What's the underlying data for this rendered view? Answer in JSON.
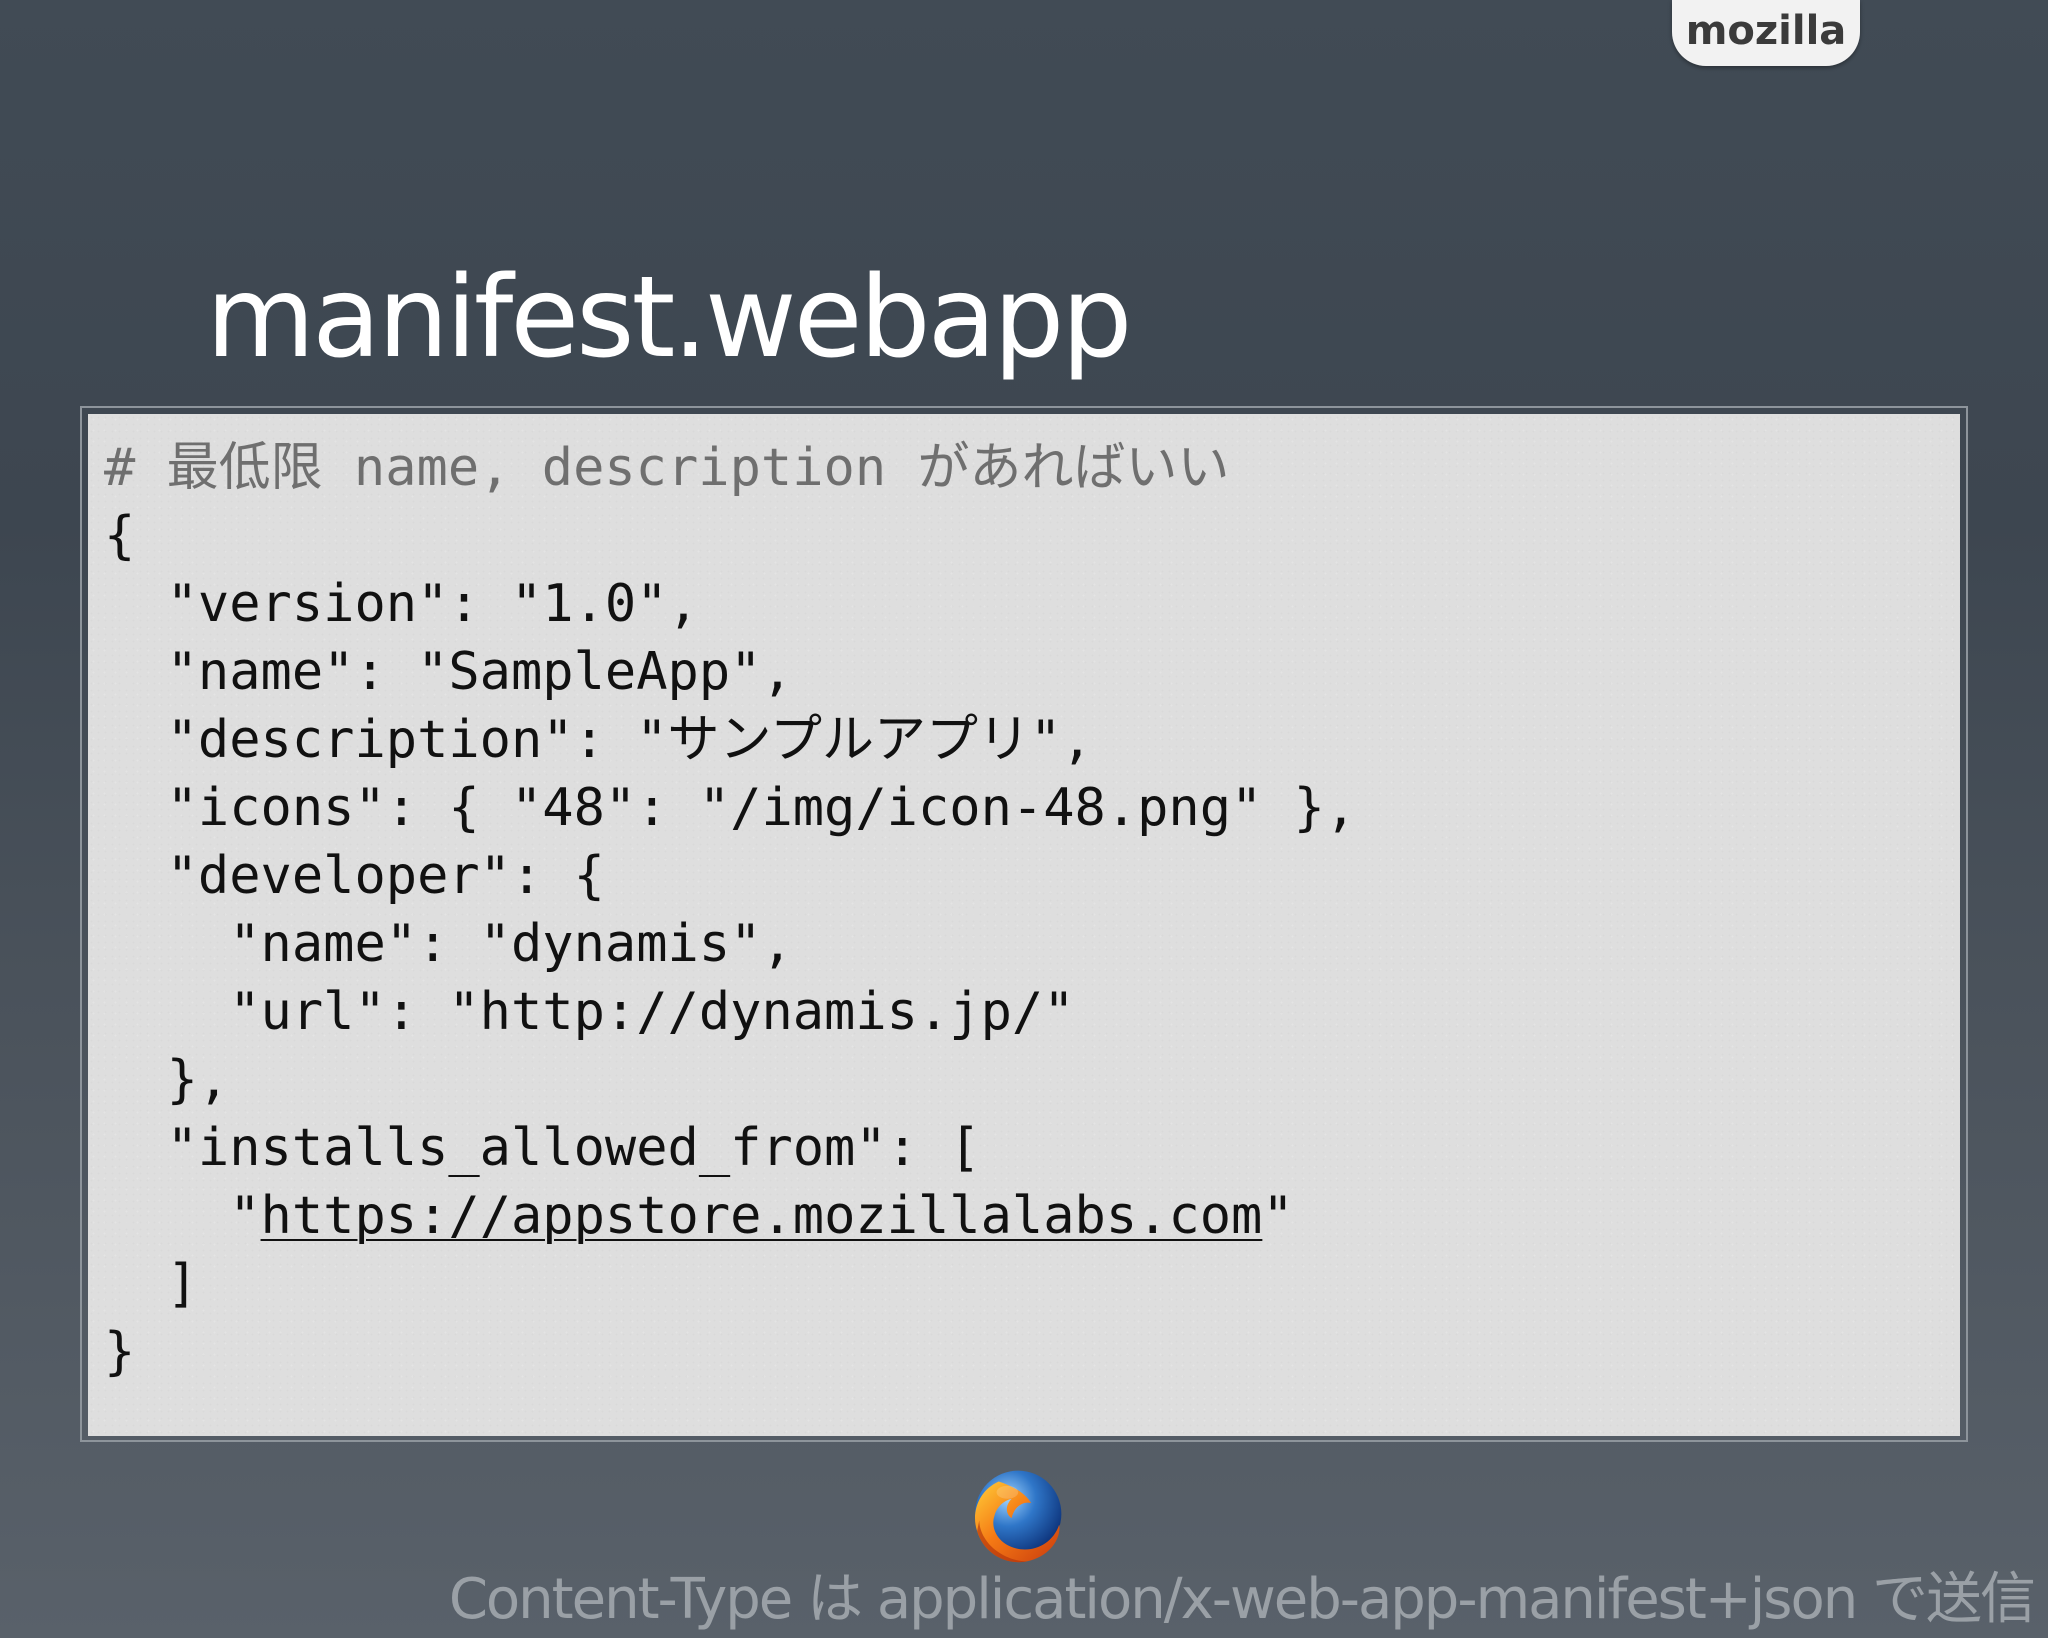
{
  "brand": {
    "label": "mozilla"
  },
  "slide": {
    "title": "manifest.webapp",
    "footer": "Content-Type は application/x-web-app-manifest+json で送信"
  },
  "code": {
    "comment": "# 最低限 name, description があればいい",
    "lines": [
      "{",
      "  \"version\": \"1.0\",",
      "  \"name\": \"SampleApp\",",
      "  \"description\": \"サンプルアプリ\",",
      "  \"icons\": { \"48\": \"/img/icon-48.png\" },",
      "  \"developer\": {",
      "    \"name\": \"dynamis\",",
      "    \"url\": \"http://dynamis.jp/\"",
      "  },",
      "  \"installs_allowed_from\": [",
      "    \"",
      "  ]",
      "}"
    ],
    "url_prefix": "    \"",
    "url": "https://appstore.mozillalabs.com",
    "url_suffix": "\""
  },
  "icons": {
    "logo": "firefox-logo-icon"
  }
}
